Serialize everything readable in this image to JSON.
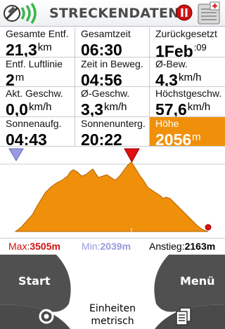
{
  "header": {
    "title": "STRECKENDATEN",
    "icons": {
      "logo": "satellite-signal-icon",
      "pause": "pause-button-icon",
      "device": "device-status-icon"
    }
  },
  "grid": [
    {
      "label": "Gesamte Entf.",
      "value": "21,3",
      "unit": "km"
    },
    {
      "label": "Gesamtzeit",
      "value": "06:30",
      "unit": ""
    },
    {
      "label": "Zurückgesetzt",
      "value": "1Feb",
      "unit": ":09"
    },
    {
      "label": "Entf. Luftlinie",
      "value": "2",
      "unit": "m"
    },
    {
      "label": "Zeit in Beweg.",
      "value": "04:56",
      "unit": ""
    },
    {
      "label": "Ø-Bew.",
      "value": "4,3",
      "unit": "km/h"
    },
    {
      "label": "Akt. Geschw.",
      "value": "0,0",
      "unit": "km/h"
    },
    {
      "label": "Ø-Geschw.",
      "value": "3,3",
      "unit": "km/h"
    },
    {
      "label": "Höchstgeschw.",
      "value": "57,6",
      "unit": "km/h"
    },
    {
      "label": "Sonnenaufg.",
      "value": "04:43",
      "unit": ""
    },
    {
      "label": "Sonnenunterg.",
      "value": "20:22",
      "unit": ""
    },
    {
      "label": "Höhe",
      "value": "2056",
      "unit": "m",
      "active": true
    }
  ],
  "stats": {
    "max_key": "Max:",
    "max_val": "3505m",
    "min_key": "Min:",
    "min_val": "2039m",
    "asc_key": "Anstieg:",
    "asc_val": "2163m"
  },
  "bottom": {
    "start_label": "Start",
    "menu_label": "Menü",
    "center_line1": "Einheiten",
    "center_line2": "metrisch"
  },
  "colors": {
    "accent": "#f0900a",
    "max": "#d01010",
    "min": "#9a9ae0",
    "button": "#505050"
  }
}
